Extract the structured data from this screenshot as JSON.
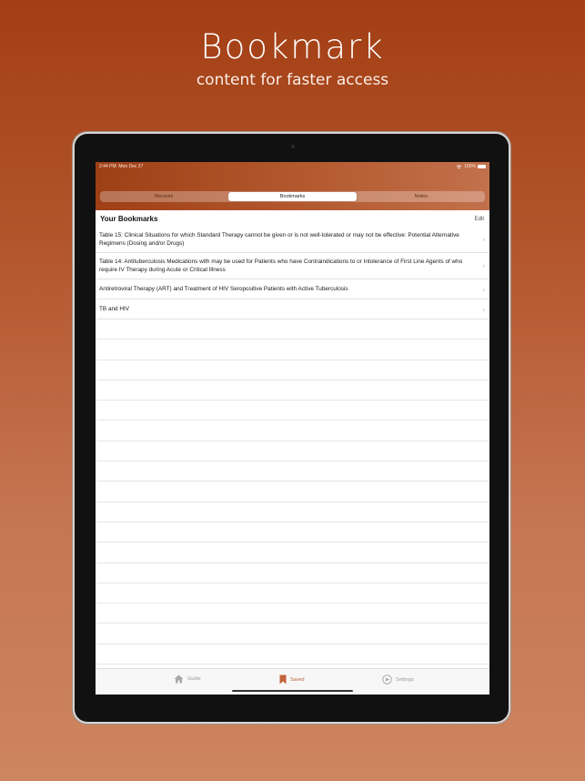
{
  "hero": {
    "title": "Bookmark",
    "subtitle": "content for faster access"
  },
  "status_bar": {
    "time": "2:44 PM",
    "date": "Mon Dec 27",
    "battery": "100%"
  },
  "segments": {
    "items": [
      "Recents",
      "Bookmarks",
      "Notes"
    ],
    "active": "Bookmarks"
  },
  "list": {
    "title": "Your Bookmarks",
    "edit_label": "Edit",
    "items": [
      {
        "text": "Table 15: Clinical Situations for which Standard Therapy cannot be given or is not well-tolerated or may not be effective: Potential Alternative Regimens (Dosing and/or Drugs)"
      },
      {
        "text": "Table 14: Antituberculosis Medications with may be used for Patients who have Contraindications to or Intolerance of First Line Agents of who require IV Therapy during Acute or Critical Illness"
      },
      {
        "text": "Antiretroviral Therapy (ART) and Treatment of HIV Seropositive Patients with Active Tuberculosis"
      },
      {
        "text": "TB and HIV"
      }
    ]
  },
  "tabbar": {
    "items": [
      {
        "label": "Guide",
        "icon": "house-icon"
      },
      {
        "label": "Saved",
        "icon": "bookmark-icon"
      },
      {
        "label": "Settings",
        "icon": "settings-icon"
      }
    ],
    "active": "Saved"
  },
  "colors": {
    "brand": "#b2542b",
    "tab_active": "#c0643c"
  }
}
